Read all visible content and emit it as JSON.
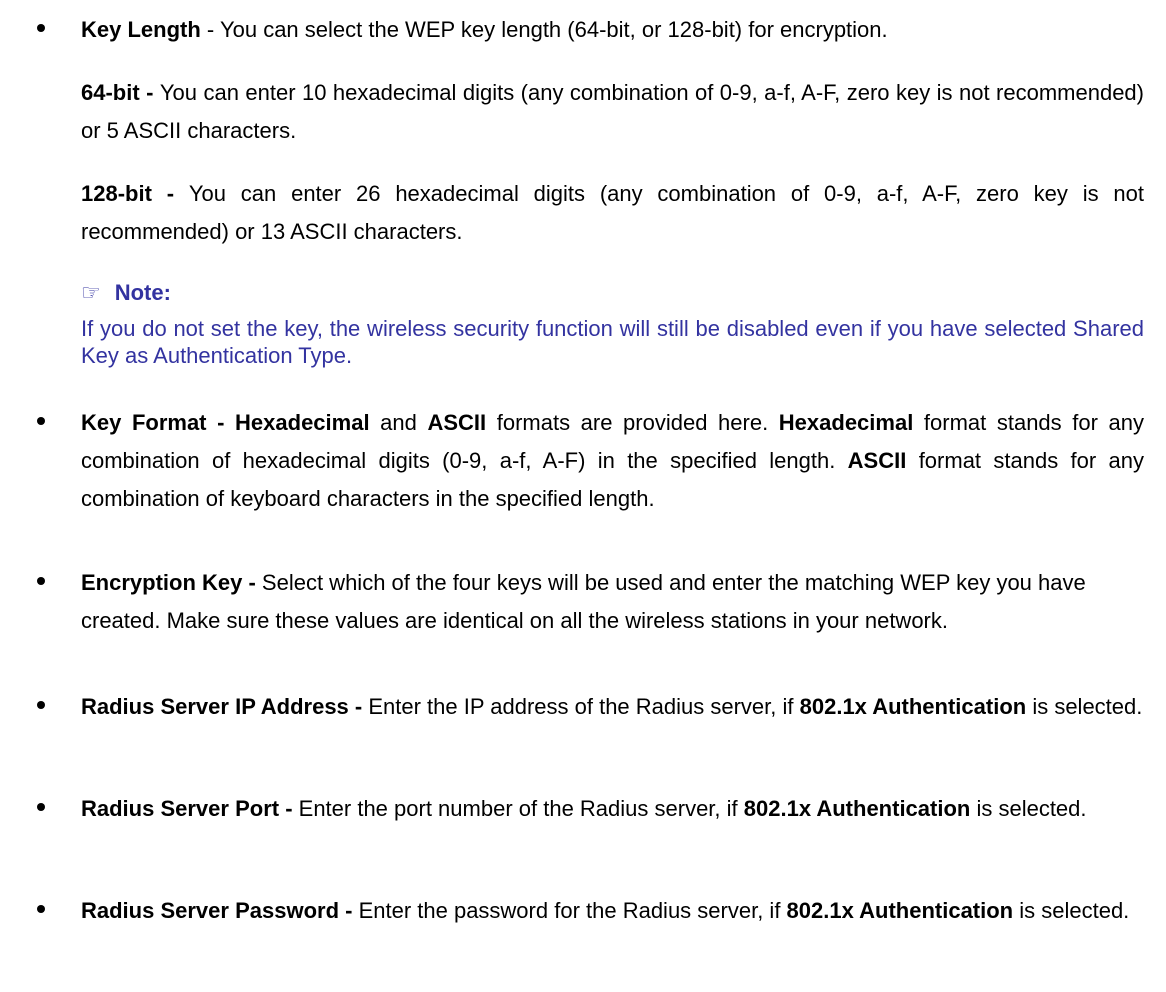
{
  "key_length": {
    "label": "Key Length",
    "text": " - You can select the WEP key length (64-bit, or 128-bit) for encryption."
  },
  "bit64": {
    "label": "64-bit - ",
    "text": " You can enter 10 hexadecimal digits (any combination of 0-9, a-f, A-F, zero key is not recommended) or 5 ASCII characters."
  },
  "bit128": {
    "label": "128-bit - ",
    "text": "You can enter 26 hexadecimal digits (any combination of 0-9, a-f, A-F, zero key is not recommended) or 13 ASCII characters."
  },
  "note": {
    "icon": "pointing-hand-icon",
    "heading": "Note:",
    "text": "If you do not set the key, the wireless security function will still be disabled even if you have selected Shared Key as Authentication Type."
  },
  "key_format": {
    "label": "Key Format - ",
    "hex": "Hexadecimal",
    "and": " and ",
    "ascii": "ASCII",
    "text1": " formats are provided here. ",
    "hex2": "Hexadecimal",
    "text2": " format stands for any combination of hexadecimal digits (0-9, a-f, A-F) in the specified length. ",
    "ascii2": "ASCII",
    "text3": " format stands for any combination of keyboard characters in the specified length."
  },
  "encryption_key": {
    "label": "Encryption Key - ",
    "text": "Select which of the four keys will be used and enter the matching WEP key you have created. Make sure these values are identical on all the wireless stations in your network."
  },
  "radius_ip": {
    "label": "Radius Server IP Address - ",
    "text": "Enter the IP address of the Radius server, if ",
    "bold": "802.1x Authentication",
    "tail": " is selected."
  },
  "radius_port": {
    "label": "Radius Server Port - ",
    "text": "Enter the port number of the Radius server, if ",
    "bold": "802.1x Authentication",
    "tail": " is selected."
  },
  "radius_password": {
    "label": "Radius Server Password - ",
    "text": "Enter the password for the Radius server, if ",
    "bold": "802.1x Authentication",
    "tail": " is selected."
  }
}
